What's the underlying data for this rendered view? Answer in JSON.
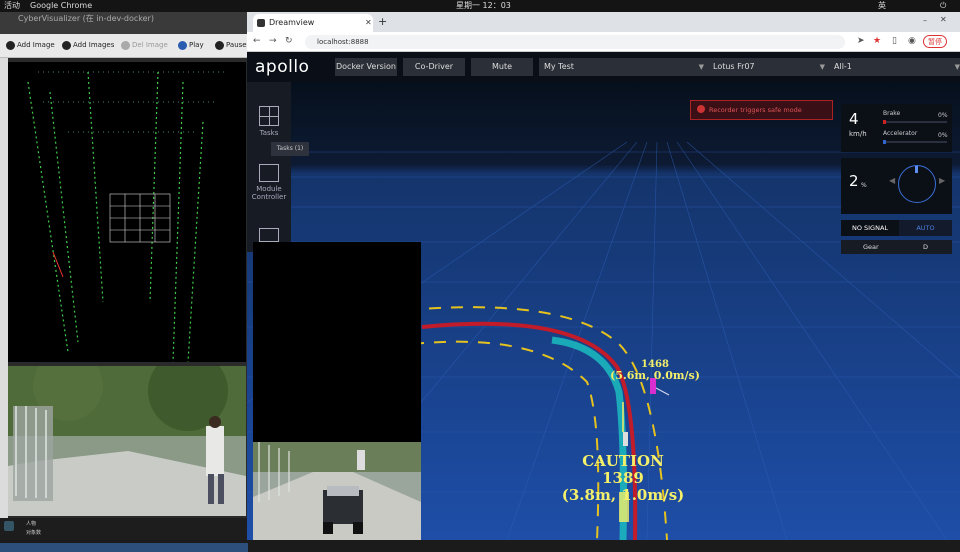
{
  "topbar": {
    "activities": "活动",
    "app": "Google Chrome",
    "clock": "星期一 12：03",
    "lang": "英"
  },
  "cyber": {
    "title": "CyberVisualizer (在 in-dev-docker)",
    "toolbar": [
      "Add Image",
      "Add Images",
      "Del Image",
      "Play",
      "Pause"
    ],
    "status_items": [
      "人物",
      "对象数"
    ]
  },
  "chrome": {
    "tab_title": "Dreamview",
    "url": "localhost:8888",
    "profile": "暂停"
  },
  "header": {
    "logo": "apollo",
    "docker_version": "Docker Version",
    "co_driver": "Co-Driver",
    "mute": "Mute",
    "mode": "My Test",
    "vehicle": "Lotus Fr07",
    "map": "All-1"
  },
  "side_menu": {
    "tasks": "Tasks",
    "tasks_tooltip": "Tasks (1)",
    "module": "Module",
    "controller": "Controller"
  },
  "notification": "Recorder triggers safe mode",
  "dashboard": {
    "speed": "4",
    "speed_unit": "km/h",
    "brake_label": "Brake",
    "brake_pct": "0%",
    "brake": 0,
    "accel_label": "Accelerator",
    "accel_pct": "0%",
    "accelerator": 0,
    "steering": "2",
    "steering_unit": "%",
    "signal": "NO SIGNAL",
    "drive_mode": "AUTO",
    "gear_label": "Gear",
    "gear": "D"
  },
  "obstacles": [
    {
      "id": "1468",
      "info": "(5.6m, 0.0m/s)"
    },
    {
      "status": "CAUTION",
      "id": "1389",
      "info": "(3.8m, 1.0m/s)"
    }
  ],
  "colors": {
    "accent": "#1f4fb0",
    "planning": "#1bbcc0",
    "reference": "#c21b2a",
    "label": "#f4f06a",
    "obstacle": "#d92ed0"
  }
}
